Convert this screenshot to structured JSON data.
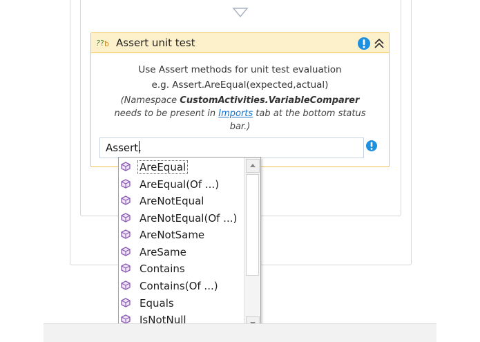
{
  "activity": {
    "title": "Assert unit test",
    "desc_line1": "Use Assert methods for unit test evaluation",
    "desc_line2": "e.g. Assert.AreEqual(expected,actual)",
    "ns_prefix": "(Namespace ",
    "ns_name": "CustomActivities.VariableComparer",
    "ns_line2_prefix": "needs to be present in ",
    "ns_link": "Imports",
    "ns_line2_suffix": " tab at the bottom status",
    "ns_line3": "bar.)"
  },
  "expression": {
    "value": "Assert."
  },
  "autocomplete": {
    "items": [
      {
        "label": "AreEqual"
      },
      {
        "label": "AreEqual(Of ...)"
      },
      {
        "label": "AreNotEqual"
      },
      {
        "label": "AreNotEqual(Of ...)"
      },
      {
        "label": "AreNotSame"
      },
      {
        "label": "AreSame"
      },
      {
        "label": "Contains"
      },
      {
        "label": "Contains(Of ...)"
      },
      {
        "label": "Equals"
      },
      {
        "label": "IsNotNull"
      }
    ],
    "selected_index": 0
  },
  "colors": {
    "header_bg": "#fdf1cc",
    "border_accent": "#f0c14b",
    "warning_blue": "#1e90e0",
    "method_icon": "#8a5bb0",
    "link": "#1a73c8"
  },
  "icons": {
    "activity": "assert-activity-icon",
    "header_warning": "warning-icon",
    "collapse": "collapse-chevron-icon",
    "expression_warning": "warning-icon",
    "method": "method-cube-icon"
  }
}
